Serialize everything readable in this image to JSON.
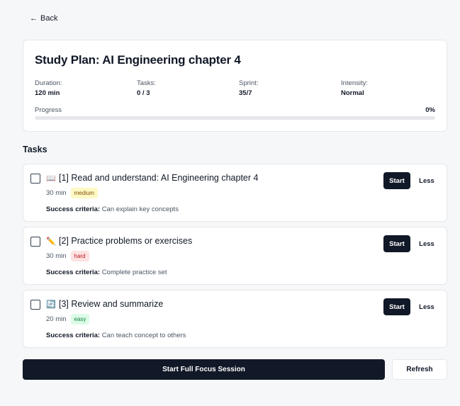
{
  "nav": {
    "back_label": "Back",
    "back_icon": "arrow-left-icon"
  },
  "plan": {
    "title": "Study Plan: AI Engineering chapter 4",
    "stats": [
      {
        "label": "Duration:",
        "value": "120 min"
      },
      {
        "label": "Tasks:",
        "value": "0 / 3"
      },
      {
        "label": "Sprint:",
        "value": "35/7"
      },
      {
        "label": "Intensity:",
        "value": "Normal"
      }
    ],
    "progress_label": "Progress",
    "progress_text": "0%",
    "progress_fraction": 0
  },
  "tasks_heading": "Tasks",
  "tasks": [
    {
      "icon": "📖",
      "icon_name": "book-icon",
      "title": "[1] Read and understand: AI Engineering chapter 4",
      "duration": "30 min",
      "difficulty": "medium",
      "criteria_label": "Success criteria:",
      "criteria": "Can explain key concepts",
      "start_label": "Start",
      "less_label": "Less",
      "checked": false
    },
    {
      "icon": "✏️",
      "icon_name": "pencil-icon",
      "title": "[2] Practice problems or exercises",
      "duration": "30 min",
      "difficulty": "hard",
      "criteria_label": "Success criteria:",
      "criteria": "Complete practice set",
      "start_label": "Start",
      "less_label": "Less",
      "checked": false
    },
    {
      "icon": "🔄",
      "icon_name": "refresh-cycle-icon",
      "title": "[3] Review and summarize",
      "duration": "20 min",
      "difficulty": "easy",
      "criteria_label": "Success criteria:",
      "criteria": "Can teach concept to others",
      "start_label": "Start",
      "less_label": "Less",
      "checked": false
    }
  ],
  "actions": {
    "focus_label": "Start Full Focus Session",
    "refresh_label": "Refresh"
  },
  "colors": {
    "primary": "#111827",
    "background": "#f6f7f9",
    "medium_badge": "#fef9c3",
    "hard_badge": "#fee2e2",
    "easy_badge": "#dcfce7"
  }
}
